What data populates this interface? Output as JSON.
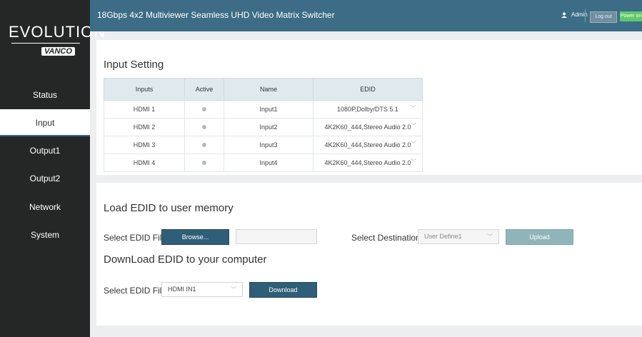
{
  "header": {
    "title": "18Gbps 4x2 Multiviewer Seamless UHD Video Matrix Switcher",
    "user": "Admin",
    "logout": "Log out",
    "power": "Power on"
  },
  "logo": {
    "text": "EVOLUTION",
    "brand": "VANCO"
  },
  "sidebar": {
    "items": [
      {
        "label": "Status"
      },
      {
        "label": "Input"
      },
      {
        "label": "Output1"
      },
      {
        "label": "Output2"
      },
      {
        "label": "Network"
      },
      {
        "label": "System"
      }
    ],
    "active": "Input"
  },
  "input_setting": {
    "title": "Input Setting",
    "columns": [
      "Inputs",
      "Active",
      "Name",
      "EDID"
    ],
    "rows": [
      {
        "input": "HDMI 1",
        "name": "Input1",
        "edid": "1080P,Dolby/DTS 5.1"
      },
      {
        "input": "HDMI 2",
        "name": "Input2",
        "edid": "4K2K60_444,Stereo Audio 2.0"
      },
      {
        "input": "HDMI 3",
        "name": "Input3",
        "edid": "4K2K60_444,Stereo Audio 2.0"
      },
      {
        "input": "HDMI 4",
        "name": "Input4",
        "edid": "4K2K60_444,Stereo Audio 2.0"
      }
    ]
  },
  "load_edid": {
    "title": "Load EDID to user memory",
    "file_label": "Select EDID File:",
    "browse": "Browse...",
    "dest_label": "Select Destination:",
    "dest_value": "User Define1",
    "upload": "Upload"
  },
  "download_edid": {
    "title": "DownLoad EDID to your computer",
    "file_label": "Select EDID File:",
    "file_value": "HDMI IN1",
    "download": "Download"
  },
  "colors": {
    "topbar": "#3d6d86",
    "sidebar": "#252626",
    "button": "#2f5e77",
    "power": "#5fc86a"
  }
}
